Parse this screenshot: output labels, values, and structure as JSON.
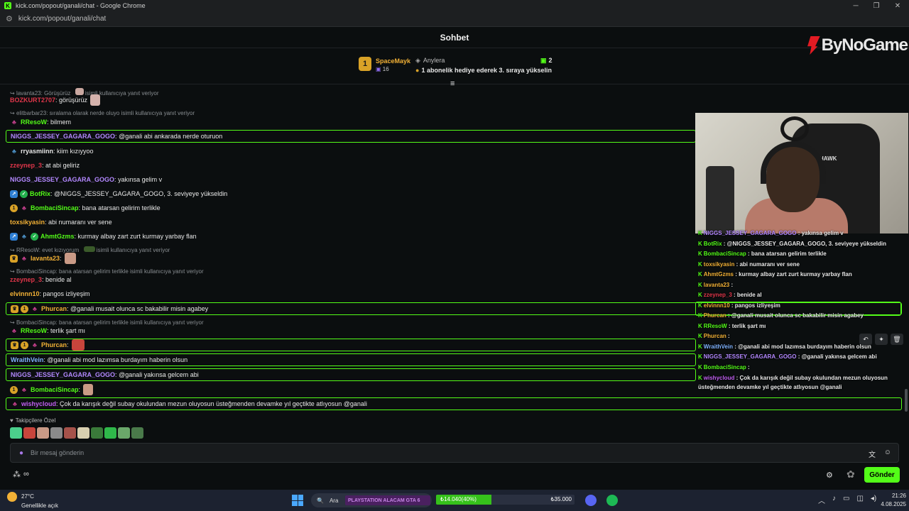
{
  "window": {
    "title": "kick.com/popout/ganali/chat - Google Chrome",
    "url": "kick.com/popout/ganali/chat",
    "favicon": "K"
  },
  "header": {
    "title": "Sohbet"
  },
  "brand": {
    "logo_text": "ByNoGame"
  },
  "pinned": {
    "rank": "1",
    "top_user": "SpaceMayk",
    "top_count": "16",
    "second_user": "Anylera",
    "second_count": "2",
    "cta": "1 abonelik hediye ederek 3. sıraya yükselin"
  },
  "messages": [
    {
      "reply": "lavanta23: Görüşürüz",
      "reply_suffix": "isimli kullanıcıya yanıt veriyor"
    },
    {
      "user": "BOZKURT2707",
      "text": "görüşürüz",
      "color": "#e0364a"
    },
    {
      "reply": "elitbarbar23: sıralama olarak nerde oluyo isimli kullanıcıya yanıt veriyor"
    },
    {
      "user": "RResoW",
      "text": "bilmem",
      "color": "#53fc18"
    },
    {
      "user": "NIGGS_JESSEY_GAGARA_GOGO",
      "text": "@ganali abi ankarada nerde oturuon",
      "color": "#b388ff"
    },
    {
      "user": "rryasmiinn",
      "text": "kiim kızıyyoo",
      "color": "#e8e8e8"
    },
    {
      "user": "zzeynep_3",
      "text": "at abi geliriz",
      "color": "#e0364a"
    },
    {
      "user": "NIGGS_JESSEY_GAGARA_GOGO",
      "text": "yakınsa gelim v",
      "color": "#b388ff"
    },
    {
      "user": "BotRix",
      "text": "@NIGGS_JESSEY_GAGARA_GOGO, 3. seviyeye yükseldin",
      "color": "#53fc18"
    },
    {
      "user": "BombaciSincap",
      "text": "bana atarsan gelirim terlikle",
      "color": "#53fc18"
    },
    {
      "user": "toxsikyasin",
      "text": "abi numaranı ver sene",
      "color": "#f2b136"
    },
    {
      "user": "AhmtGzms",
      "text": "kurmay albay zart zurt kurmay yarbay flan",
      "color": "#53fc18"
    },
    {
      "reply": "RResoW: evet kızıyorum",
      "reply_suffix": "isimli kullanıcıya yanıt veriyor"
    },
    {
      "user": "lavanta23",
      "text": "",
      "color": "#f2b136"
    },
    {
      "reply": "BombaciSincap: bana atarsan gelirim terlikle isimli kullanıcıya yanıt veriyor"
    },
    {
      "user": "zzeynep_3",
      "text": "benide al",
      "color": "#e0364a"
    },
    {
      "user": "elvinnn10",
      "text": "pangos izliyeşim",
      "color": "#f2b136"
    },
    {
      "user": "Phurcan",
      "text": "@ganali musait olunca sc bakabilir misin agabey",
      "color": "#f2b136"
    },
    {
      "reply": "BombaciSincap: bana atarsan gelirim terlikle isimli kullanıcıya yanıt veriyor"
    },
    {
      "user": "RResoW",
      "text": "terlik şart mı",
      "color": "#53fc18"
    },
    {
      "user": "Phurcan",
      "text": "",
      "color": "#f2b136"
    },
    {
      "user": "WraithVein",
      "text": "@ganali abi mod lazımsa burdayım haberin olsun",
      "color": "#7fb3ff"
    },
    {
      "user": "NIGGS_JESSEY_GAGARA_GOGO",
      "text": "@ganali yakınsa gelcem abi",
      "color": "#b388ff"
    },
    {
      "user": "BombaciSincap",
      "text": "",
      "color": "#53fc18"
    },
    {
      "user": "wishycloud",
      "text": "Çok da karışık değil subay okulundan mezun oluyosun üsteğmenden devamke yıl geçtikte atlıyosun @ganali",
      "color": "#c05ff0"
    }
  ],
  "overlay": {
    "lines": [
      {
        "user": "NIGGS_JESSEY_GAGARA_GOGO",
        "text": "yakınsa gelim v",
        "color": "#b388ff"
      },
      {
        "user": "BotRix",
        "text": "@NIGGS_JESSEY_GAGARA_GOGO, 3. seviyeye yükseldin",
        "color": "#53fc18"
      },
      {
        "user": "BombaciSincap",
        "text": "bana atarsan gelirim terlikle",
        "color": "#53fc18"
      },
      {
        "user": "toxsikyasin",
        "text": "abi numaranı ver sene",
        "color": "#f2b136"
      },
      {
        "user": "AhmtGzms",
        "text": "kurmay albay zart zurt kurmay yarbay flan",
        "color": "#f2b136"
      },
      {
        "user": "lavanta23",
        "text": "",
        "color": "#f2b136"
      },
      {
        "user": "zzeynep_3",
        "text": "benide al",
        "color": "#e0364a"
      },
      {
        "user": "elvinnn10",
        "text": "pangos izliyeşim",
        "color": "#f2b136"
      },
      {
        "user": "Phurcan",
        "text": "@ganali musait olunca sc bakabilir misin agabey",
        "color": "#f2b136"
      },
      {
        "user": "RResoW",
        "text": "terlik şart mı",
        "color": "#53fc18"
      },
      {
        "user": "Phurcan",
        "text": "",
        "color": "#f2b136"
      },
      {
        "user": "WraithVein",
        "text": "@ganali abi mod lazımsa burdayım haberin olsun",
        "color": "#7fb3ff"
      },
      {
        "user": "NIGGS_JESSEY_GAGARA_GOGO",
        "text": "@ganali yakınsa gelcem abi",
        "color": "#b388ff"
      },
      {
        "user": "BombaciSincap",
        "text": "",
        "color": "#53fc18"
      },
      {
        "user": "wishycloud",
        "text": "Çok da karışık değil subay okulundan mezun oluyosun",
        "color": "#c05ff0"
      },
      {
        "user": "",
        "text": "üsteğmenden devamke yıl geçtikte atlıyosun @ganali",
        "color": "#e8e8e8"
      }
    ]
  },
  "webcam": {
    "chair_label": "HAWK"
  },
  "followers_only": {
    "label": "Takipçilere Özel"
  },
  "composer": {
    "placeholder": "Bir mesaj gönderin",
    "send_label": "Gönder"
  },
  "taskbar": {
    "weather_temp": "27°C",
    "weather_desc": "Genellikle açık",
    "search_label": "Ara",
    "promo_text": "PLAYSTATION ALACAM GTA 6",
    "goal_current": "₺14.040(40%)",
    "goal_target": "₺35.000",
    "goal_progress": 0.4,
    "time": "21:26",
    "date": "4.08.2025"
  }
}
